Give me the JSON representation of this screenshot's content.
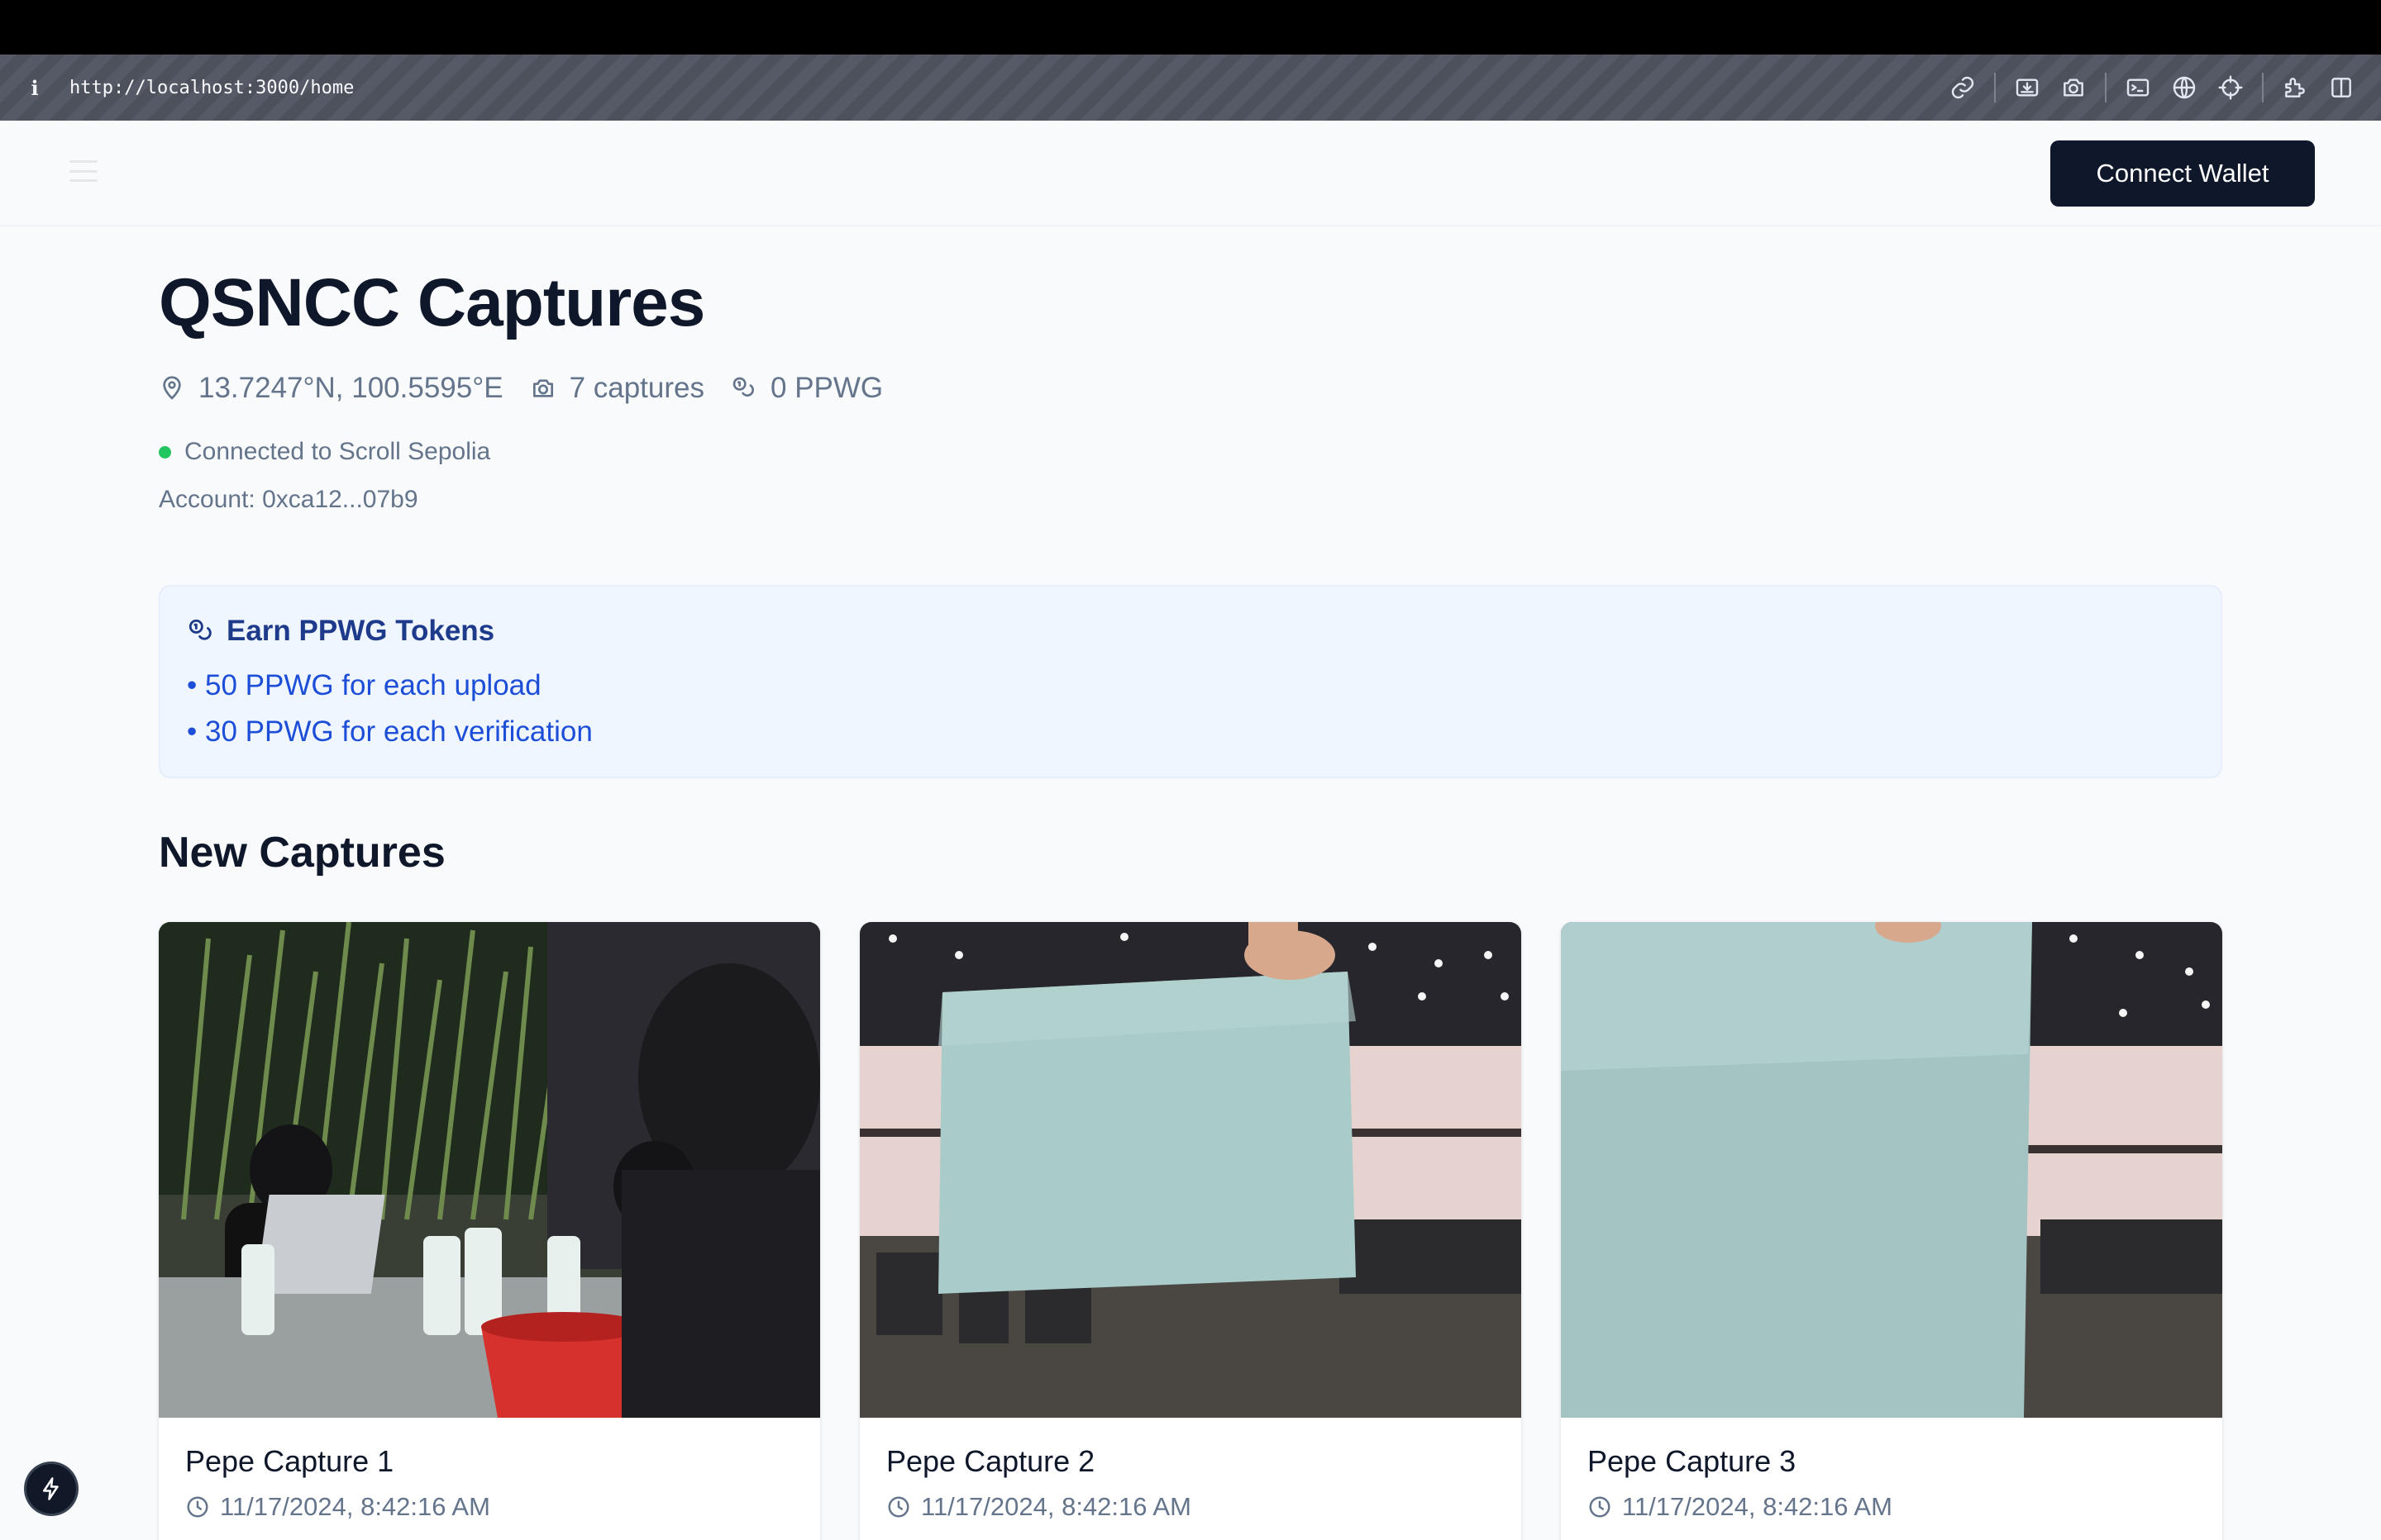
{
  "browser": {
    "url": "http://localhost:3000/home",
    "info_icon": "i",
    "tools": [
      "link-icon",
      "download-icon",
      "camera-icon",
      "terminal-icon",
      "globe-icon",
      "crosshair-icon",
      "extension-icon",
      "split-view-icon"
    ]
  },
  "header": {
    "menu_icon": "hamburger-icon",
    "connect_label": "Connect Wallet"
  },
  "page": {
    "title": "QSNCC Captures",
    "coordinates": "13.7247°N, 100.5595°E",
    "captures_count": "7 captures",
    "token_balance": "0 PPWG",
    "network_status": "Connected to Scroll Sepolia",
    "account": "Account: 0xca12...07b9"
  },
  "earn": {
    "title": "Earn PPWG Tokens",
    "items": [
      "• 50 PPWG for each upload",
      "• 30 PPWG for each verification"
    ]
  },
  "captures": {
    "section_title": "New Captures",
    "items": [
      {
        "title": "Pepe Capture 1",
        "timestamp": "11/17/2024, 8:42:16 AM"
      },
      {
        "title": "Pepe Capture 2",
        "timestamp": "11/17/2024, 8:42:16 AM"
      },
      {
        "title": "Pepe Capture 3",
        "timestamp": "11/17/2024, 8:42:16 AM"
      }
    ]
  },
  "colors": {
    "primary_button": "#0f172a",
    "status_green": "#22c55e",
    "earn_bg": "#eff6ff",
    "earn_text": "#1d4ed8"
  }
}
